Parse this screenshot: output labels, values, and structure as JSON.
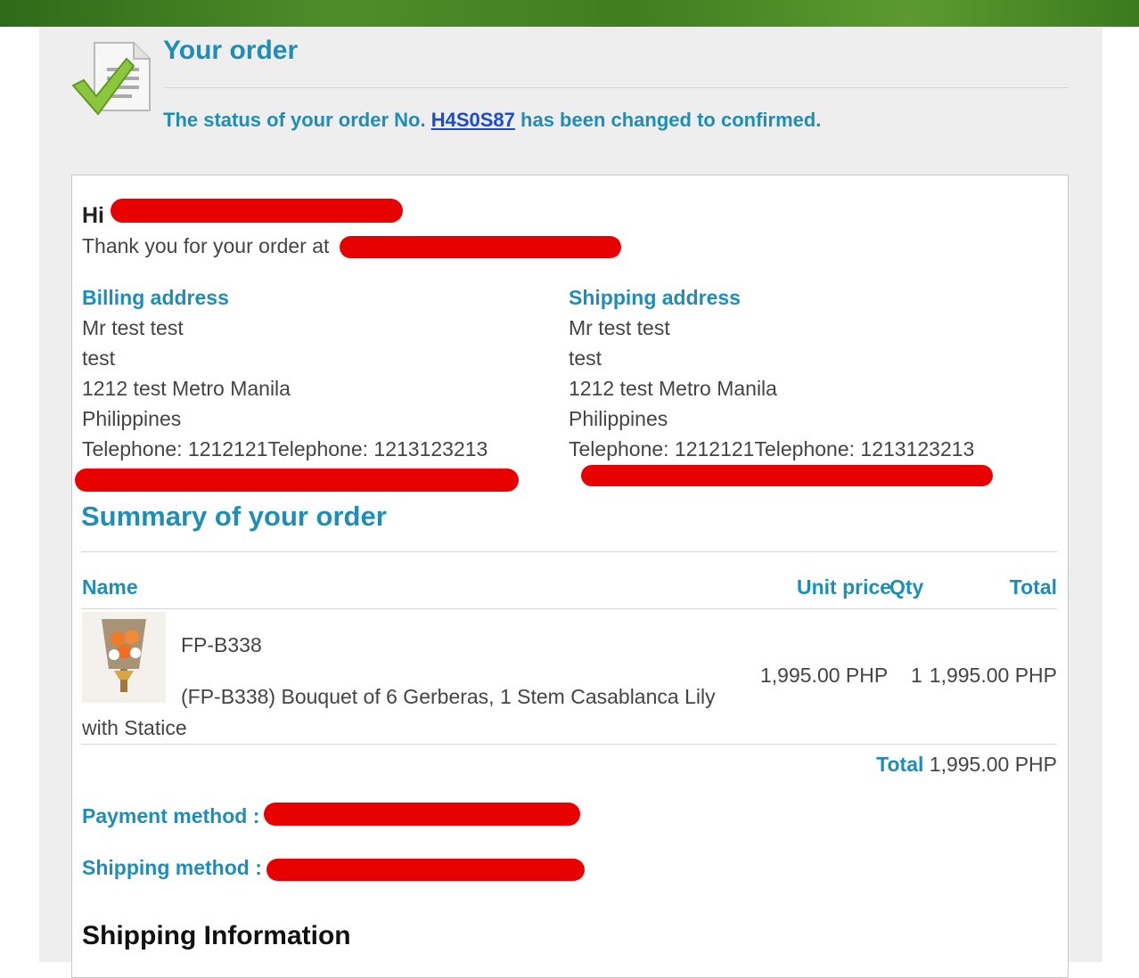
{
  "header": {
    "title": "Your order",
    "status_prefix": "The status of your order No.",
    "order_number": "H4S0S87",
    "status_suffix": "has been changed to confirmed."
  },
  "greeting": {
    "hi": "Hi",
    "thanks": "Thank you for your order at"
  },
  "billing": {
    "heading": "Billing address",
    "lines": [
      "Mr test test",
      "test",
      "1212 test Metro Manila",
      "Philippines",
      "Telephone: 1212121Telephone: 1213123213"
    ]
  },
  "shipping_address": {
    "heading": "Shipping address",
    "lines": [
      "Mr test test",
      "test",
      "1212 test Metro Manila",
      "Philippines",
      "Telephone: 1212121Telephone: 1213123213"
    ]
  },
  "summary": {
    "heading": "Summary of your order",
    "columns": {
      "name": "Name",
      "unit_price": "Unit price",
      "qty": "Qty",
      "total": "Total"
    },
    "item": {
      "sku": "FP-B338",
      "description_line1": "(FP-B338) Bouquet of 6 Gerberas, 1 Stem Casablanca Lily",
      "description_line2": "with Statice",
      "unit_price": "1,995.00 PHP",
      "qty": "1",
      "total": "1,995.00 PHP"
    },
    "grand_total_label": "Total",
    "grand_total_value": "1,995.00 PHP"
  },
  "payment_method_label": "Payment method :",
  "shipping_method_label": "Shipping method :",
  "shipping_info_heading": "Shipping Information"
}
